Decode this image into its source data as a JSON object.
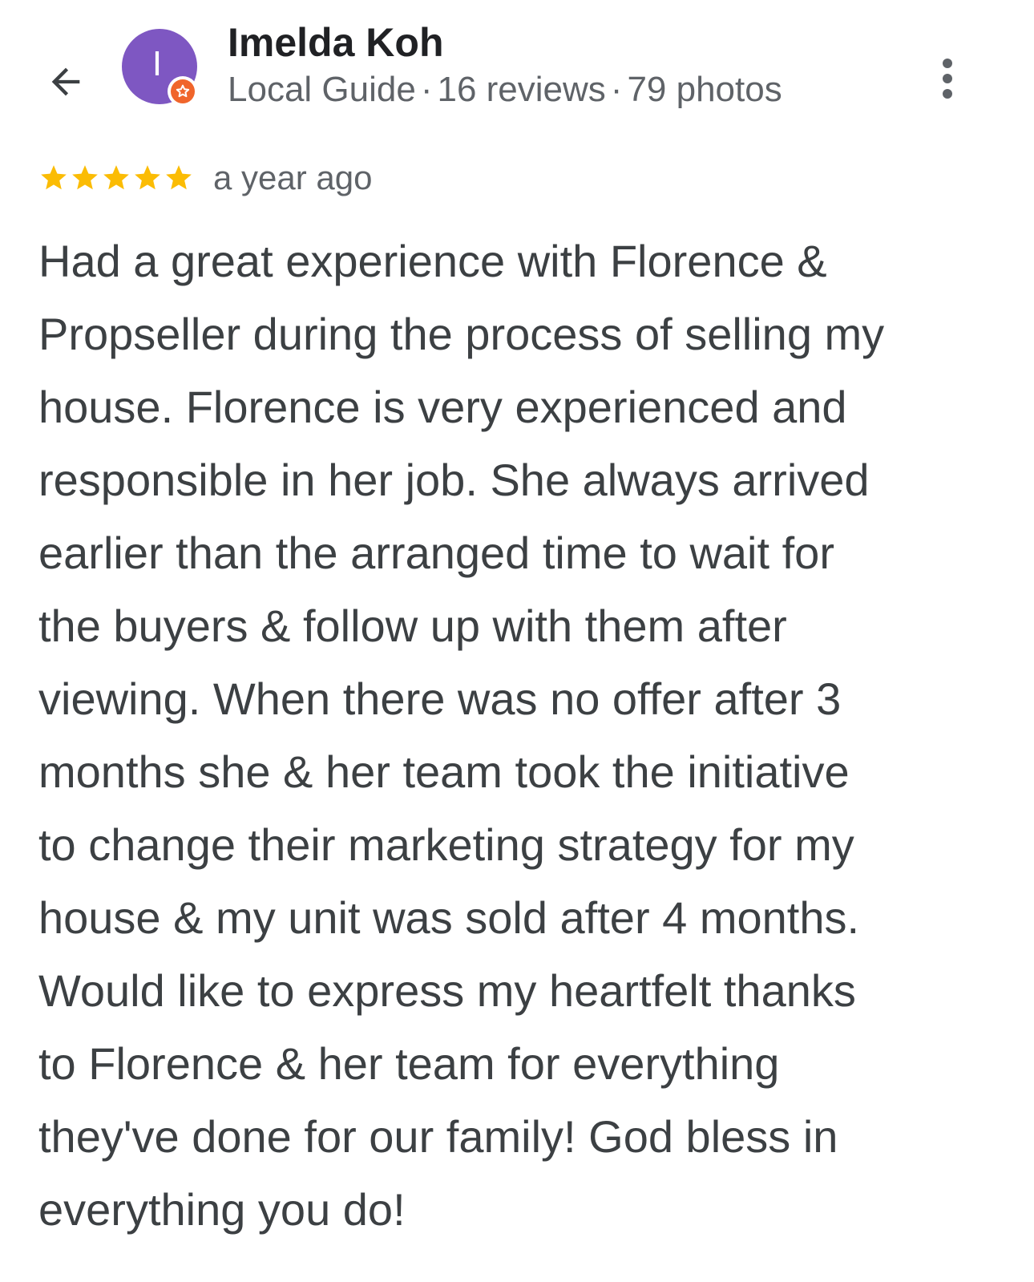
{
  "header": {
    "back_icon": "arrow-left-icon",
    "avatar_letter": "I",
    "avatar_color": "#7e57c2",
    "badge_icon": "local-guide-star-icon",
    "badge_color": "#f0652b",
    "reviewer_name": "Imelda Koh",
    "guide_label": "Local Guide",
    "separator": "·",
    "reviews_count": "16 reviews",
    "photos_count": "79 photos",
    "more_icon": "more-vert-icon"
  },
  "review": {
    "rating": 5,
    "rating_max": 5,
    "star_color": "#fbbc04",
    "date": "a year ago",
    "lines": [
      "Had a great experience with Florence &",
      "Propseller during the process of selling my",
      "house. Florence is very experienced and",
      "responsible in her job. She always arrived",
      "earlier than the arranged time to wait for",
      "the buyers & follow up with them after",
      "viewing. When there was no offer after 3",
      "months she & her team took the initiative",
      "to change their marketing strategy for my",
      "house & my unit was sold after 4 months.",
      "Would like to express my heartfelt thanks",
      "to Florence & her team for everything",
      "they've done for our family! God bless in",
      "everything you do!"
    ]
  }
}
